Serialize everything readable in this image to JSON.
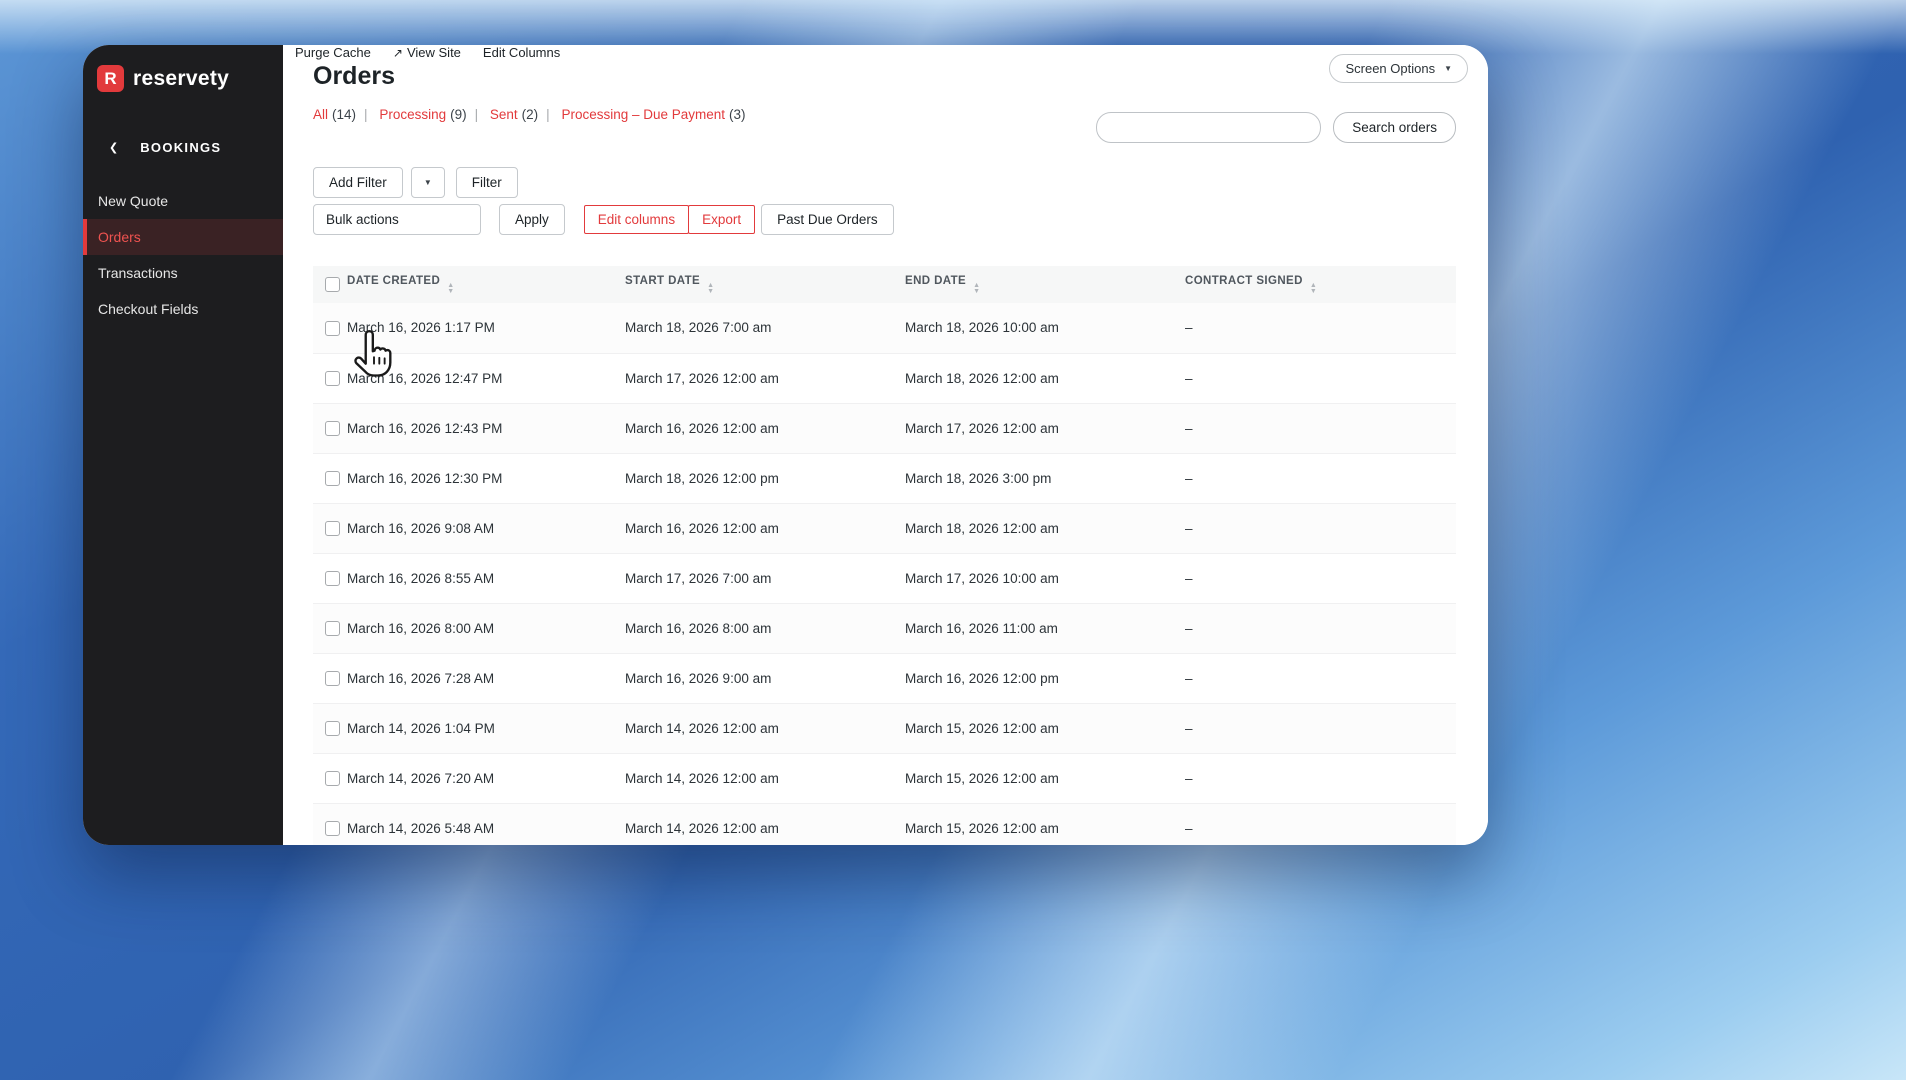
{
  "colors": {
    "accent": "#e23a3c",
    "sidebar_bg": "#1d1d1f",
    "sidebar_active_bg": "#3a2224",
    "sidebar_active_text": "#ef5350"
  },
  "sidebar": {
    "logo": {
      "letter": "R",
      "text": "reservety"
    },
    "section_label": "BOOKINGS",
    "items": [
      {
        "label": "New Quote",
        "active": false
      },
      {
        "label": "Orders",
        "active": true
      },
      {
        "label": "Transactions",
        "active": false
      },
      {
        "label": "Checkout Fields",
        "active": false
      }
    ]
  },
  "topbar": {
    "purge_cache": "Purge Cache",
    "view_site": "View Site",
    "edit_columns": "Edit Columns"
  },
  "page": {
    "title": "Orders",
    "screen_options_label": "Screen Options"
  },
  "status_filters": {
    "separator": "|",
    "items": [
      {
        "label": "All",
        "count": "(14)"
      },
      {
        "label": "Processing",
        "count": "(9)"
      },
      {
        "label": "Sent",
        "count": "(2)"
      },
      {
        "label": "Processing – Due Payment",
        "count": "(3)"
      }
    ]
  },
  "search": {
    "input_value": "",
    "button_label": "Search orders"
  },
  "toolbar": {
    "add_filter_label": "Add Filter",
    "filter_label": "Filter",
    "bulk_actions_label": "Bulk actions",
    "apply_label": "Apply",
    "edit_columns_label": "Edit columns",
    "export_label": "Export",
    "past_due_label": "Past Due Orders"
  },
  "table": {
    "columns": [
      "Date Created",
      "Start Date",
      "End Date",
      "Contract Signed"
    ],
    "rows": [
      {
        "date_created": "March 16, 2026 1:17 PM",
        "start_date": "March 18, 2026 7:00 am",
        "end_date": "March 18, 2026 10:00 am",
        "contract_signed": "–"
      },
      {
        "date_created": "March 16, 2026 12:47 PM",
        "start_date": "March 17, 2026 12:00 am",
        "end_date": "March 18, 2026 12:00 am",
        "contract_signed": "–"
      },
      {
        "date_created": "March 16, 2026 12:43 PM",
        "start_date": "March 16, 2026 12:00 am",
        "end_date": "March 17, 2026 12:00 am",
        "contract_signed": "–"
      },
      {
        "date_created": "March 16, 2026 12:30 PM",
        "start_date": "March 18, 2026 12:00 pm",
        "end_date": "March 18, 2026 3:00 pm",
        "contract_signed": "–"
      },
      {
        "date_created": "March 16, 2026 9:08 AM",
        "start_date": "March 16, 2026 12:00 am",
        "end_date": "March 18, 2026 12:00 am",
        "contract_signed": "–"
      },
      {
        "date_created": "March 16, 2026 8:55 AM",
        "start_date": "March 17, 2026 7:00 am",
        "end_date": "March 17, 2026 10:00 am",
        "contract_signed": "–"
      },
      {
        "date_created": "March 16, 2026 8:00 AM",
        "start_date": "March 16, 2026 8:00 am",
        "end_date": "March 16, 2026 11:00 am",
        "contract_signed": "–"
      },
      {
        "date_created": "March 16, 2026 7:28 AM",
        "start_date": "March 16, 2026 9:00 am",
        "end_date": "March 16, 2026 12:00 pm",
        "contract_signed": "–"
      },
      {
        "date_created": "March 14, 2026 1:04 PM",
        "start_date": "March 14, 2026 12:00 am",
        "end_date": "March 15, 2026 12:00 am",
        "contract_signed": "–"
      },
      {
        "date_created": "March 14, 2026 7:20 AM",
        "start_date": "March 14, 2026 12:00 am",
        "end_date": "March 15, 2026 12:00 am",
        "contract_signed": "–"
      },
      {
        "date_created": "March 14, 2026 5:48 AM",
        "start_date": "March 14, 2026 12:00 am",
        "end_date": "March 15, 2026 12:00 am",
        "contract_signed": "–"
      }
    ]
  },
  "icons": {
    "external_link": "↗",
    "chevron_left": "❮",
    "caret_down": "▼",
    "sort_asc": "▲",
    "sort_desc": "▼"
  }
}
